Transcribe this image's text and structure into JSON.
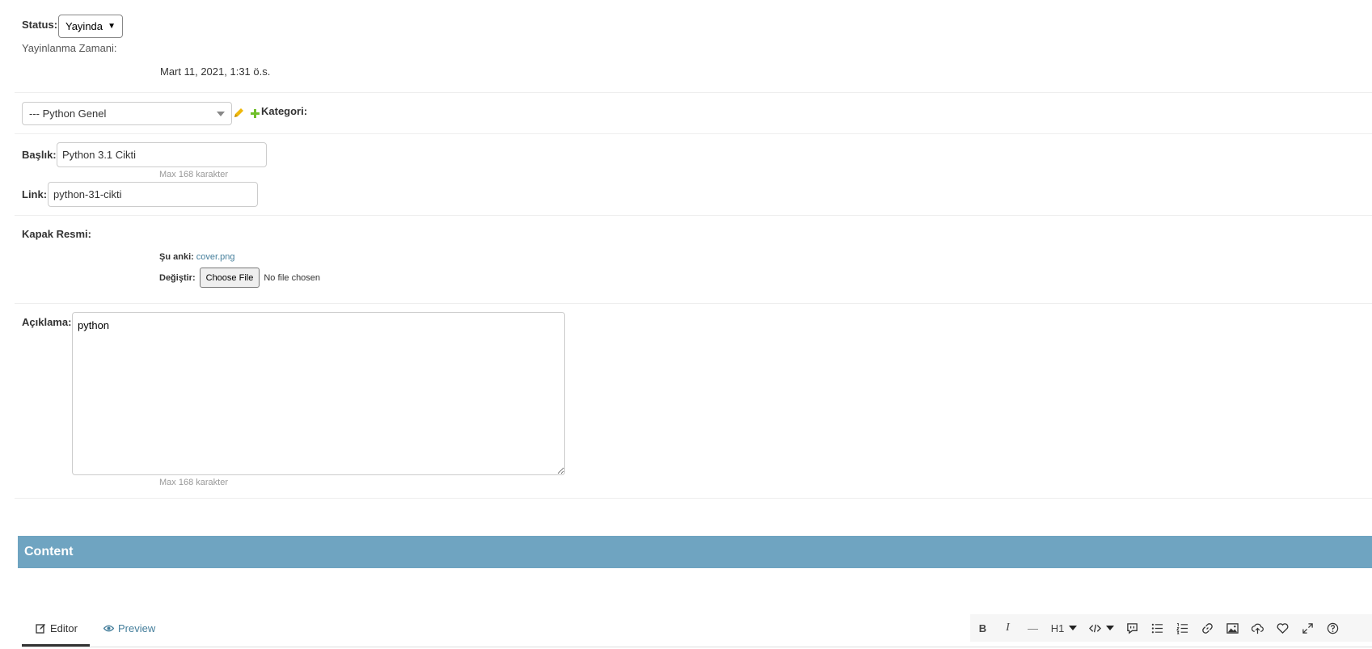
{
  "status": {
    "label": "Status:",
    "selected": "Yayinda"
  },
  "publish": {
    "label": "Yayinlanma Zamani:",
    "value": "Mart 11, 2021, 1:31 ö.s."
  },
  "category": {
    "selected": "--- Python Genel",
    "label": "Kategori:"
  },
  "title_field": {
    "label": "Başlık:",
    "value": "Python 3.1 Cikti",
    "help": "Max 168 karakter"
  },
  "link_field": {
    "label": "Link:",
    "value": "python-31-cikti"
  },
  "cover": {
    "label": "Kapak Resmi:",
    "current_label": "Şu anki:",
    "current_file": "cover.png",
    "change_label": "Değiştir:",
    "choose_button": "Choose File",
    "no_file": "No file chosen"
  },
  "description": {
    "label": "Açıklama:",
    "value": "python",
    "help": "Max 168 karakter"
  },
  "content": {
    "title": "Content"
  },
  "editor_tabs": [
    {
      "label": "Editor",
      "icon": "edit-icon"
    },
    {
      "label": "Preview",
      "icon": "eye-icon"
    }
  ],
  "toolbar": {
    "bold": "B",
    "italic": "I",
    "hr": "—",
    "heading": "H1"
  },
  "colors": {
    "content_bar": "#6fa4c1",
    "link": "#447e9b",
    "edit_icon": "#efb80b",
    "add_icon": "#70bf2b"
  }
}
